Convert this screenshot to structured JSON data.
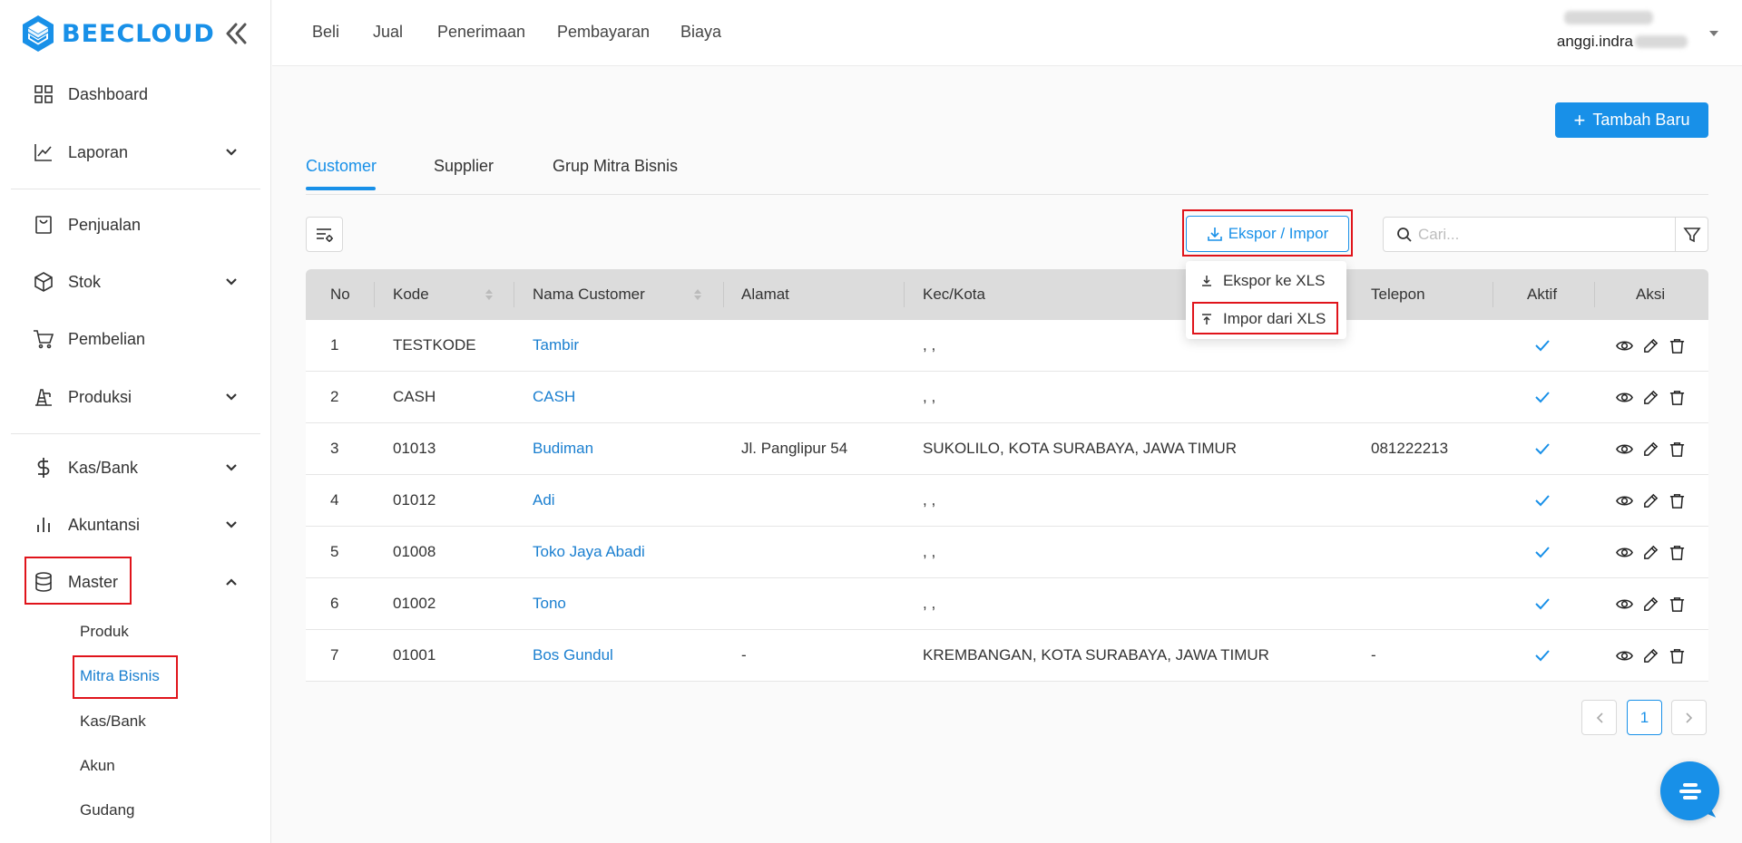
{
  "brand": {
    "name": "BEECLOUD",
    "color": "#1890e8"
  },
  "sidebar": {
    "items": [
      {
        "label": "Dashboard",
        "icon": "dashboard-grid-icon"
      },
      {
        "label": "Laporan",
        "icon": "line-chart-icon",
        "expandable": true
      },
      {
        "label": "Penjualan",
        "icon": "shopping-bag-icon"
      },
      {
        "label": "Stok",
        "icon": "box-icon",
        "expandable": true
      },
      {
        "label": "Pembelian",
        "icon": "cart-icon"
      },
      {
        "label": "Produksi",
        "icon": "factory-icon",
        "expandable": true
      },
      {
        "label": "Kas/Bank",
        "icon": "dollar-icon",
        "expandable": true
      },
      {
        "label": "Akuntansi",
        "icon": "bar-chart-icon",
        "expandable": true
      },
      {
        "label": "Master",
        "icon": "database-icon",
        "expanded": true
      }
    ],
    "master_sub": [
      "Produk",
      "Mitra Bisnis",
      "Kas/Bank",
      "Akun",
      "Gudang"
    ],
    "active_sub": "Mitra Bisnis"
  },
  "topnav": {
    "links": [
      "Beli",
      "Jual",
      "Penerimaan",
      "Pembayaran",
      "Biaya"
    ],
    "user_email_visible": "anggi.indra"
  },
  "toolbar": {
    "add_label": "Tambah Baru",
    "export_label": "Ekspor / Impor",
    "search_placeholder": "Cari..."
  },
  "tabs": [
    "Customer",
    "Supplier",
    "Grup Mitra Bisnis"
  ],
  "active_tab": "Customer",
  "dropdown": [
    "Ekspor ke XLS",
    "Impor dari XLS"
  ],
  "table": {
    "columns": [
      "No",
      "Kode",
      "Nama Customer",
      "Alamat",
      "Kec/Kota",
      "Telepon",
      "Aktif",
      "Aksi"
    ],
    "rows": [
      {
        "no": "1",
        "kode": "TESTKODE",
        "nama": "Tambir",
        "alamat": "",
        "kota": ", ,",
        "telepon": "",
        "aktif": true
      },
      {
        "no": "2",
        "kode": "CASH",
        "nama": "CASH",
        "alamat": "",
        "kota": ", ,",
        "telepon": "",
        "aktif": true
      },
      {
        "no": "3",
        "kode": "01013",
        "nama": "Budiman",
        "alamat": "Jl. Panglipur 54",
        "kota": "SUKOLILO, KOTA SURABAYA, JAWA TIMUR",
        "telepon": "081222213",
        "aktif": true
      },
      {
        "no": "4",
        "kode": "01012",
        "nama": "Adi",
        "alamat": "",
        "kota": ", ,",
        "telepon": "",
        "aktif": true
      },
      {
        "no": "5",
        "kode": "01008",
        "nama": "Toko Jaya Abadi",
        "alamat": "",
        "kota": ", ,",
        "telepon": "",
        "aktif": true
      },
      {
        "no": "6",
        "kode": "01002",
        "nama": "Tono",
        "alamat": "",
        "kota": ", ,",
        "telepon": "",
        "aktif": true
      },
      {
        "no": "7",
        "kode": "01001",
        "nama": "Bos Gundul",
        "alamat": "-",
        "kota": "KREMBANGAN, KOTA SURABAYA, JAWA TIMUR",
        "telepon": "-",
        "aktif": true
      }
    ]
  },
  "pagination": {
    "current": "1"
  },
  "colors": {
    "accent": "#1890e8",
    "highlight": "#e0141b",
    "header_bg": "#dcdcdc"
  }
}
